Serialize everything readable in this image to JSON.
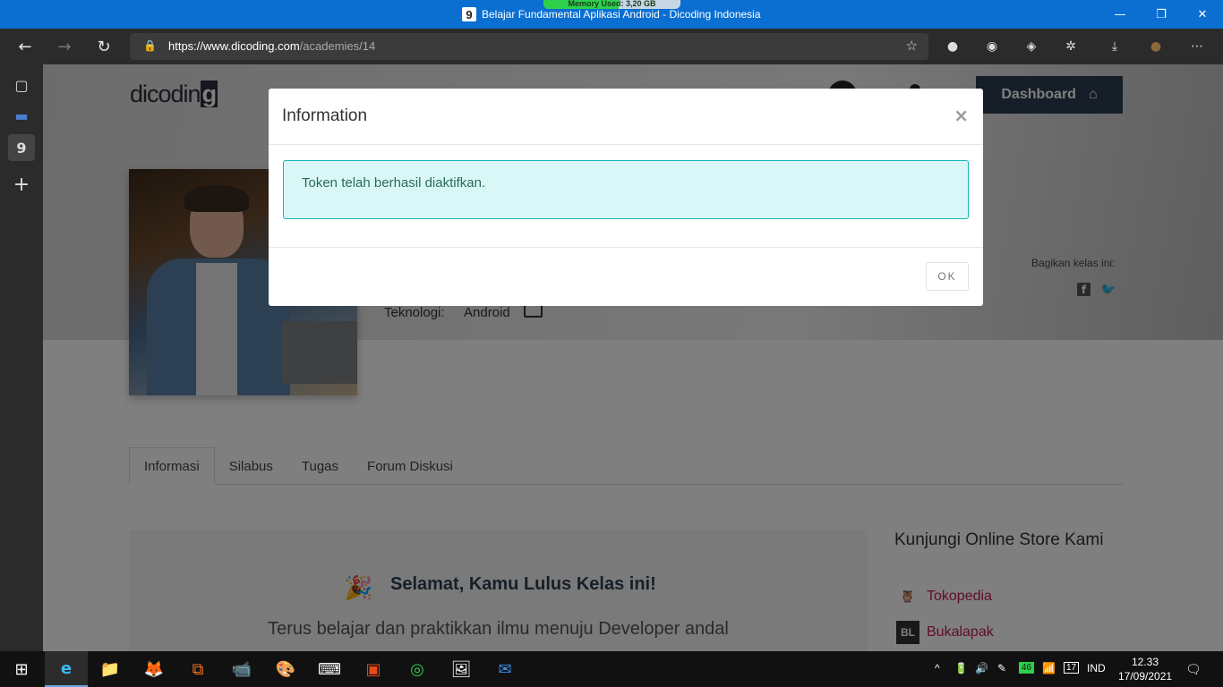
{
  "window": {
    "title": "Belajar Fundamental Aplikasi Android - Dicoding Indonesia",
    "favicon": "9",
    "memory_label": "Memory Used: 3,20 GB",
    "memory_fraction": 0.55,
    "controls": {
      "minimize": "—",
      "restore": "❐",
      "close": "✕"
    }
  },
  "browser": {
    "url_host": "https://www.dicoding.com",
    "url_path": "/academies/14",
    "back": "←",
    "forward": "→",
    "refresh": "↻",
    "lock": "🔒",
    "favorite": "☆",
    "extensions": [
      "●",
      "◉",
      "◈",
      "✲",
      "⤓",
      "●",
      "⋯"
    ]
  },
  "sidebar": {
    "tabs_icon": "▢",
    "tab1": "▬",
    "tab2": "9",
    "add": "+"
  },
  "page": {
    "logo_text": "dicodin",
    "logo_box": "g",
    "dashboard_label": "Dashboard",
    "dashboard_icon": "⌂",
    "tech_label": "Teknologi:",
    "tech_value": "Android",
    "share_label": "Bagikan kelas ini:",
    "share_fb": "f",
    "share_tw": "🐦",
    "tabs": [
      "Informasi",
      "Silabus",
      "Tugas",
      "Forum Diskusi"
    ],
    "congrats_icon": "🎉",
    "congrats_title": "Selamat, Kamu Lulus Kelas ini!",
    "congrats_text": "Terus belajar dan praktikkan ilmu menuju Developer andal",
    "store_title": "Kunjungi Online Store Kami",
    "store_items": [
      {
        "icon": "🦉",
        "label": "Tokopedia"
      },
      {
        "icon": "BL",
        "label": "Bukalapak"
      }
    ]
  },
  "modal": {
    "title": "Information",
    "close": "×",
    "message": "Token telah berhasil diaktifkan.",
    "ok_label": "OK"
  },
  "taskbar": {
    "apps": [
      "⊞",
      "e",
      "📁",
      "🦊",
      "⧉",
      "📹",
      "🎨",
      "⌨",
      "▣",
      "◎",
      "🖼",
      "✉"
    ],
    "tray": {
      "chevron": "^",
      "battery": "🔋",
      "volume": "🔊",
      "pen": "✎",
      "badge": "46",
      "wifi": "📶",
      "calendar": "17",
      "lang": "IND",
      "notifications": "🗨"
    },
    "time": "12.33",
    "date": "17/09/2021"
  },
  "colors": {
    "titlebar": "#0a6fd1",
    "chrome": "#2b2b2b",
    "alert_bg": "#d9f7f7",
    "alert_border": "#15b5b5",
    "dashboard": "#2d3e50",
    "store_link": "#c2185b"
  }
}
